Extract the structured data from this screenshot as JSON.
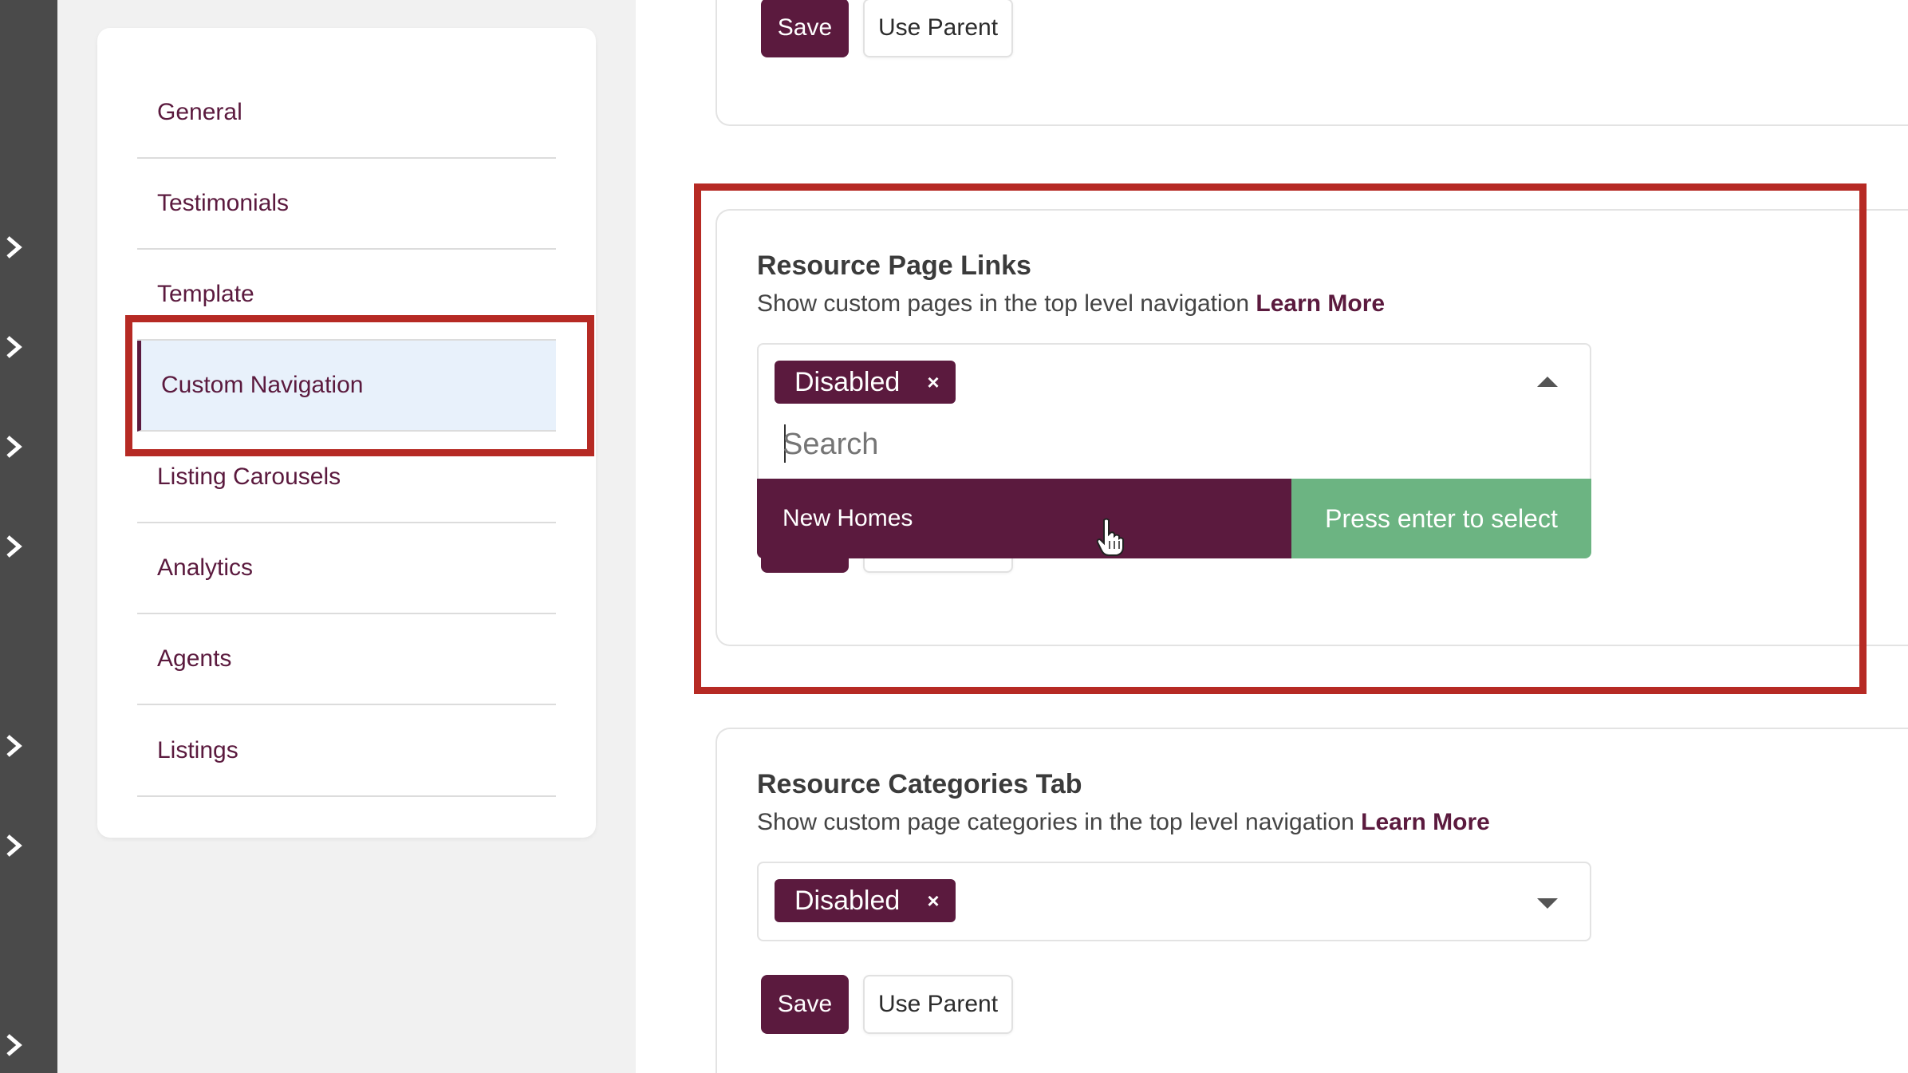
{
  "nav": {
    "items": [
      {
        "label": "General"
      },
      {
        "label": "Testimonials"
      },
      {
        "label": "Template"
      },
      {
        "label": "Custom Navigation"
      },
      {
        "label": "Listing Carousels"
      },
      {
        "label": "Analytics"
      },
      {
        "label": "Agents"
      },
      {
        "label": "Listings"
      }
    ],
    "active": "Custom Navigation"
  },
  "top_section": {
    "save_label": "Save",
    "use_parent_label": "Use Parent"
  },
  "resource_page_links": {
    "title": "Resource Page Links",
    "subtitle": "Show custom pages in the top level navigation",
    "learn_more": "Learn More",
    "selected_tag": "Disabled",
    "tag_remove": "×",
    "search_placeholder": "Search",
    "option_label": "New Homes",
    "option_hint": "Press enter to select"
  },
  "resource_categories_tab": {
    "title": "Resource Categories Tab",
    "subtitle": "Show custom page categories in the top level navigation",
    "learn_more": "Learn More",
    "selected_tag": "Disabled",
    "tag_remove": "×",
    "save_label": "Save",
    "use_parent_label": "Use Parent"
  },
  "colors": {
    "brand": "#5b1a3e",
    "success": "#6cb482",
    "highlight": "#b62a24",
    "active_bg": "#e8f1fb"
  },
  "icons": {
    "rail": "chevron-right-icon",
    "caret_open": "caret-up-icon",
    "caret_closed": "caret-down-icon",
    "pointer": "hand-pointer-icon"
  }
}
